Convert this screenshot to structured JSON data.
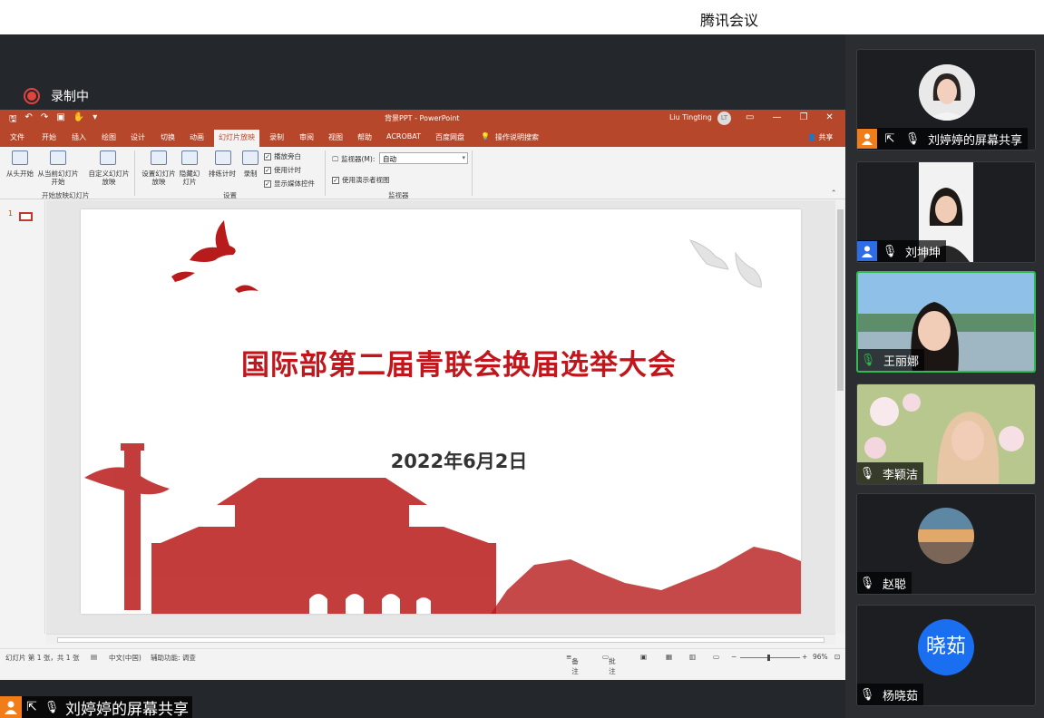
{
  "app": {
    "title": "腾讯会议",
    "recording_label": "录制中"
  },
  "ppt": {
    "doc_title": "背景PPT - PowerPoint",
    "user_name": "Liu Tingting",
    "user_initials": "LT",
    "tabs": [
      "文件",
      "开始",
      "插入",
      "绘图",
      "设计",
      "切换",
      "动画",
      "幻灯片放映",
      "录制",
      "审阅",
      "视图",
      "帮助",
      "ACROBAT",
      "百度网盘",
      "操作说明搜索"
    ],
    "active_tab": "幻灯片放映",
    "share_label": "共享",
    "ribbon": {
      "from_start": "从头开始",
      "from_current": "从当前幻灯片开始",
      "custom_show": "自定义幻灯片放映",
      "group_start": "开始放映幻灯片",
      "setup_show": "设置幻灯片放映",
      "hide_slide": "隐藏幻灯片",
      "rehearse": "排练计时",
      "record": "录制",
      "chk_narration": "播放旁白",
      "chk_timings": "使用计时",
      "chk_media": "显示媒体控件",
      "group_setup": "设置",
      "monitor_label": "监视器(M):",
      "monitor_value": "自动",
      "chk_presenter": "使用演示者视图",
      "group_monitors": "监视器"
    },
    "slide_number": "1",
    "slide": {
      "title": "国际部第二届青联会换届选举大会",
      "date": "2022年6月2日"
    },
    "status": {
      "slide_info": "幻灯片 第 1 张，共 1 张",
      "language": "中文(中国)",
      "accessibility": "辅助功能: 调查",
      "notes": "备注",
      "comments": "批注",
      "zoom": "96%"
    }
  },
  "share_badge": "刘婷婷的屏幕共享",
  "participants": [
    {
      "name": "刘婷婷的屏幕共享"
    },
    {
      "name": "刘坤坤"
    },
    {
      "name": "王丽娜"
    },
    {
      "name": "李颖洁"
    },
    {
      "name": "赵聪"
    },
    {
      "name": "杨晓茹",
      "avatar_text": "晓茹"
    }
  ]
}
